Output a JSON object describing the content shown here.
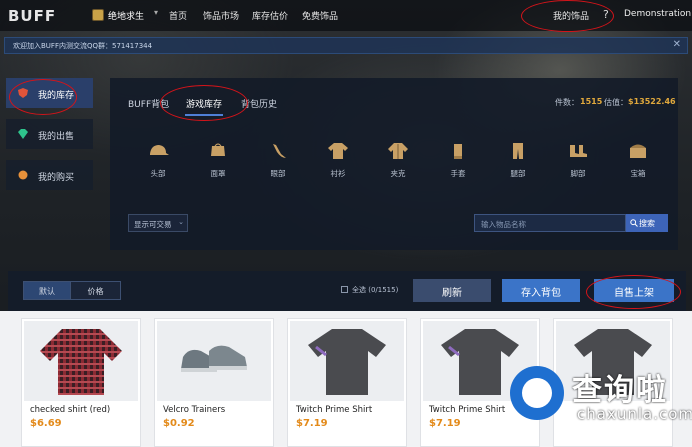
{
  "header": {
    "logo": "BUFF",
    "game": "绝地求生",
    "caret": "▾",
    "nav": [
      "首页",
      "饰品市场",
      "库存估价",
      "免费饰品"
    ],
    "my_items": "我的饰品",
    "help": "?",
    "user": "Demonstration"
  },
  "notice": {
    "text": "欢迎加入BUFF内测交流QQ群：571417344",
    "close": "✕"
  },
  "sidebar": {
    "items": [
      {
        "label": "我的库存",
        "icon": "shield-icon",
        "active": true
      },
      {
        "label": "我的出售",
        "icon": "gem-icon"
      },
      {
        "label": "我的购买",
        "icon": "bag-icon"
      }
    ]
  },
  "panel": {
    "tabs": [
      "BUFF背包",
      "游戏库存",
      "背包历史"
    ],
    "count_label": "件数：",
    "count": "1515",
    "value_label": "估值：",
    "value": "$13522.46"
  },
  "categories": [
    "头部",
    "面罩",
    "眼部",
    "衬衫",
    "夹克",
    "手套",
    "腿部",
    "脚部",
    "宝箱"
  ],
  "filter": {
    "dropdown": "显示可交易",
    "search_placeholder": "输入物品名称",
    "search_btn": "搜索"
  },
  "toolbar": {
    "seg": [
      "默认",
      "价格"
    ],
    "select_all": "全选 (0/1515)",
    "refresh": "刷新",
    "deposit": "存入背包",
    "sell": "自售上架"
  },
  "items": [
    {
      "name": "checked shirt (red)",
      "price": "$6.69"
    },
    {
      "name": "Velcro Trainers",
      "price": "$0.92"
    },
    {
      "name": "Twitch Prime Shirt",
      "price": "$7.19"
    },
    {
      "name": "Twitch Prime Shirt",
      "price": "$7.19"
    },
    {
      "name": "",
      "price": ""
    }
  ],
  "watermark": {
    "text": "查询啦",
    "url": "chaxunla.com"
  },
  "colors": {
    "accent": "#3d64b8",
    "price": "#e38a1a",
    "annotation": "#d2141a"
  }
}
